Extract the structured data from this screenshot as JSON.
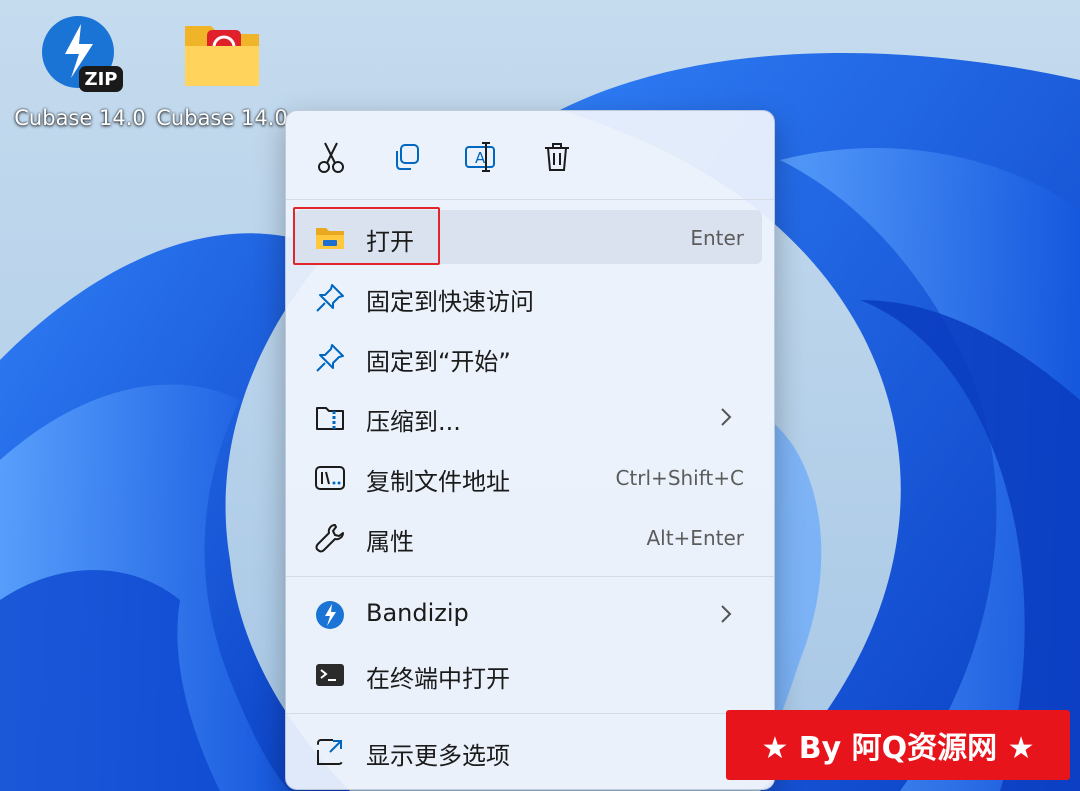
{
  "desktop": {
    "icons": [
      {
        "label": "Cubase 14.0",
        "icon": "zip-archive-icon",
        "badge": "ZIP"
      },
      {
        "label": "Cubase 14.0",
        "icon": "folder-icon"
      }
    ]
  },
  "context_menu": {
    "toolbar": [
      {
        "name": "cut",
        "icon": "scissors-icon"
      },
      {
        "name": "copy",
        "icon": "copy-icon"
      },
      {
        "name": "rename",
        "icon": "rename-icon"
      },
      {
        "name": "delete",
        "icon": "trash-icon"
      }
    ],
    "items": [
      {
        "label": "打开",
        "shortcut": "Enter",
        "icon": "folder-open-icon"
      },
      {
        "label": "固定到快速访问",
        "shortcut": "",
        "icon": "pin-icon"
      },
      {
        "label": "固定到“开始”",
        "shortcut": "",
        "icon": "pin-icon"
      },
      {
        "label": "压缩到...",
        "shortcut": "",
        "icon": "zip-folder-icon",
        "submenu": true
      },
      {
        "label": "复制文件地址",
        "shortcut": "Ctrl+Shift+C",
        "icon": "copy-path-icon"
      },
      {
        "label": "属性",
        "shortcut": "Alt+Enter",
        "icon": "wrench-icon"
      },
      {
        "label": "Bandizip",
        "shortcut": "",
        "icon": "bandizip-icon",
        "submenu": true
      },
      {
        "label": "在终端中打开",
        "shortcut": "",
        "icon": "terminal-icon"
      },
      {
        "label": "显示更多选项",
        "shortcut": "",
        "icon": "more-options-icon"
      }
    ]
  },
  "watermark": {
    "text": "★ By 阿Q资源网 ★"
  },
  "colors": {
    "accent": "#0067c0",
    "highlight_border": "#e0262b",
    "watermark_bg": "#e8141c"
  }
}
